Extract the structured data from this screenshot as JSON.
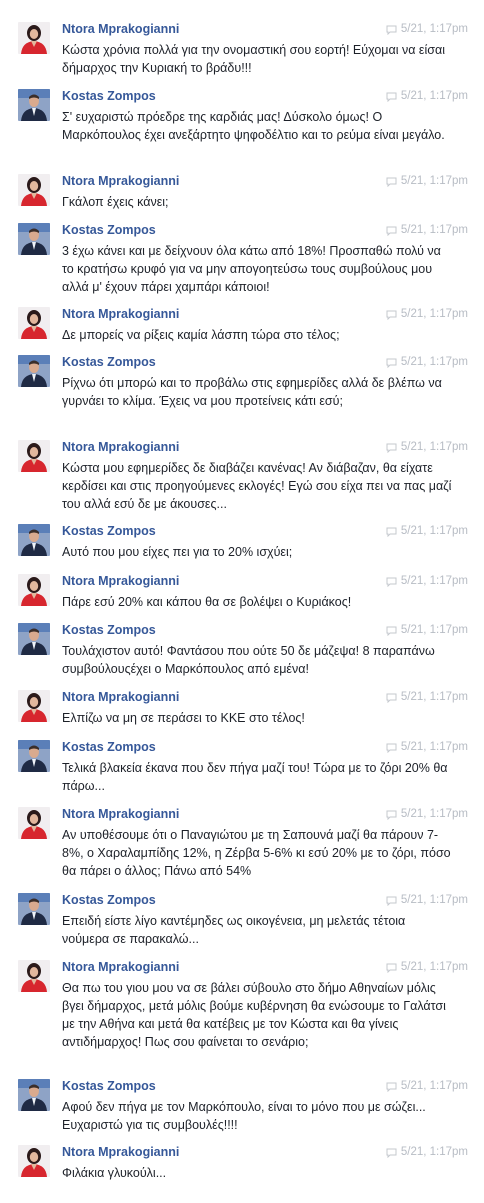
{
  "colors": {
    "author_name": "#365899",
    "message_text": "#1d2129",
    "timestamp": "#b7bcc4",
    "background": "#ffffff"
  },
  "icons": {
    "timestamp_icon": "comment-icon"
  },
  "messages": [
    {
      "author": "Ntora Mprakogianni",
      "time": "5/21, 1:17pm",
      "text": "Κώστα χρόνια πολλά για την ονομαστική σου εορτή! Εύχομαι να είσαι δήμαρχος την Κυριακή το βράδυ!!!"
    },
    {
      "author": "Kostas Zompos",
      "time": "5/21, 1:17pm",
      "text": "Σ' ευχαριστώ πρόεδρε της καρδιάς μας! Δύσκολο όμως! Ο Μαρκόπουλος έχει ανεξάρτητο ψηφοδέλτιο και το ρεύμα είναι μεγάλο."
    },
    {
      "author": "Ntora Mprakogianni",
      "time": "5/21, 1:17pm",
      "text": "Γκάλοπ έχεις κάνει;"
    },
    {
      "author": "Kostas Zompos",
      "time": "5/21, 1:17pm",
      "text": "3 έχω κάνει και με δείχνουν όλα κάτω από 18%! Προσπαθώ πολύ να το κρατήσω κρυφό για να μην απογοητεύσω τους συμβούλους μου αλλά μ' έχουν πάρει χαμπάρι κάποιοι!"
    },
    {
      "author": "Ntora Mprakogianni",
      "time": "5/21, 1:17pm",
      "text": "Δε μπορείς να ρίξεις καμία λάσπη τώρα στο τέλος;"
    },
    {
      "author": "Kostas Zompos",
      "time": "5/21, 1:17pm",
      "text": "Ρίχνω ότι μπορώ και το προβάλω στις εφημερίδες αλλά δε βλέπω να γυρνάει το κλίμα. Έχεις να μου προτείνεις κάτι εσύ;"
    },
    {
      "author": "Ntora Mprakogianni",
      "time": "5/21, 1:17pm",
      "text": "Κώστα μου εφημερίδες δε διαβάζει κανένας! Αν διάβαζαν, θα είχατε κερδίσει και στις προηγούμενες εκλογές! Εγώ σου είχα πει να πας μαζί του αλλά εσύ δε με άκουσες..."
    },
    {
      "author": "Kostas Zompos",
      "time": "5/21, 1:17pm",
      "text": "Αυτό που μου είχες πει για το 20% ισχύει;"
    },
    {
      "author": "Ntora Mprakogianni",
      "time": "5/21, 1:17pm",
      "text": "Πάρε εσύ 20% και κάπου θα σε βολέψει ο Κυριάκος!"
    },
    {
      "author": "Kostas Zompos",
      "time": "5/21, 1:17pm",
      "text": "Τουλάχιστον αυτό! Φαντάσου που ούτε 50 δε μάζεψα! 8 παραπάνω συμβούλουςέχει ο Μαρκόπουλος από εμένα!"
    },
    {
      "author": "Ntora Mprakogianni",
      "time": "5/21, 1:17pm",
      "text": "Ελπίζω να μη σε περάσει το ΚΚΕ στο τέλος!"
    },
    {
      "author": "Kostas Zompos",
      "time": "5/21, 1:17pm",
      "text": "Τελικά βλακεία έκανα που δεν πήγα μαζί του! Τώρα με το ζόρι 20% θα πάρω..."
    },
    {
      "author": "Ntora Mprakogianni",
      "time": "5/21, 1:17pm",
      "text": "Αν υποθέσουμε ότι ο Παναγιώτου με τη Σαπουνά μαζί θα πάρουν 7-8%, ο Χαραλαμπίδης 12%, η Ζέρβα 5-6% κι εσύ 20% με το ζόρι, πόσο θα πάρει ο άλλος; Πάνω από 54%"
    },
    {
      "author": "Kostas Zompos",
      "time": "5/21, 1:17pm",
      "text": "Επειδή είστε λίγο καντέμηδες ως οικογένεια, μη μελετάς τέτοια νούμερα σε παρακαλώ..."
    },
    {
      "author": "Ntora Mprakogianni",
      "time": "5/21, 1:17pm",
      "text": "Θα πω του γιου μου να σε βάλει σύβουλο στο δήμο Αθηναίων μόλις βγει δήμαρχος, μετά μόλις βούμε κυβέρνηση θα ενώσουμε το Γαλάτσι με την Αθήνα και μετά θα κατέβεις με τον Κώστα και θα γίνεις αντιδήμαρχος! Πως σου φαίνεται το σενάριο;"
    },
    {
      "author": "Kostas Zompos",
      "time": "5/21, 1:17pm",
      "text": "Αφού δεν πήγα με τον Μαρκόπουλο, είναι το μόνο που με σώζει... Ευχαριστώ για τις συμβουλές!!!!"
    },
    {
      "author": "Ntora Mprakogianni",
      "time": "5/21, 1:17pm",
      "text": "Φιλάκια γλυκούλι..."
    }
  ]
}
